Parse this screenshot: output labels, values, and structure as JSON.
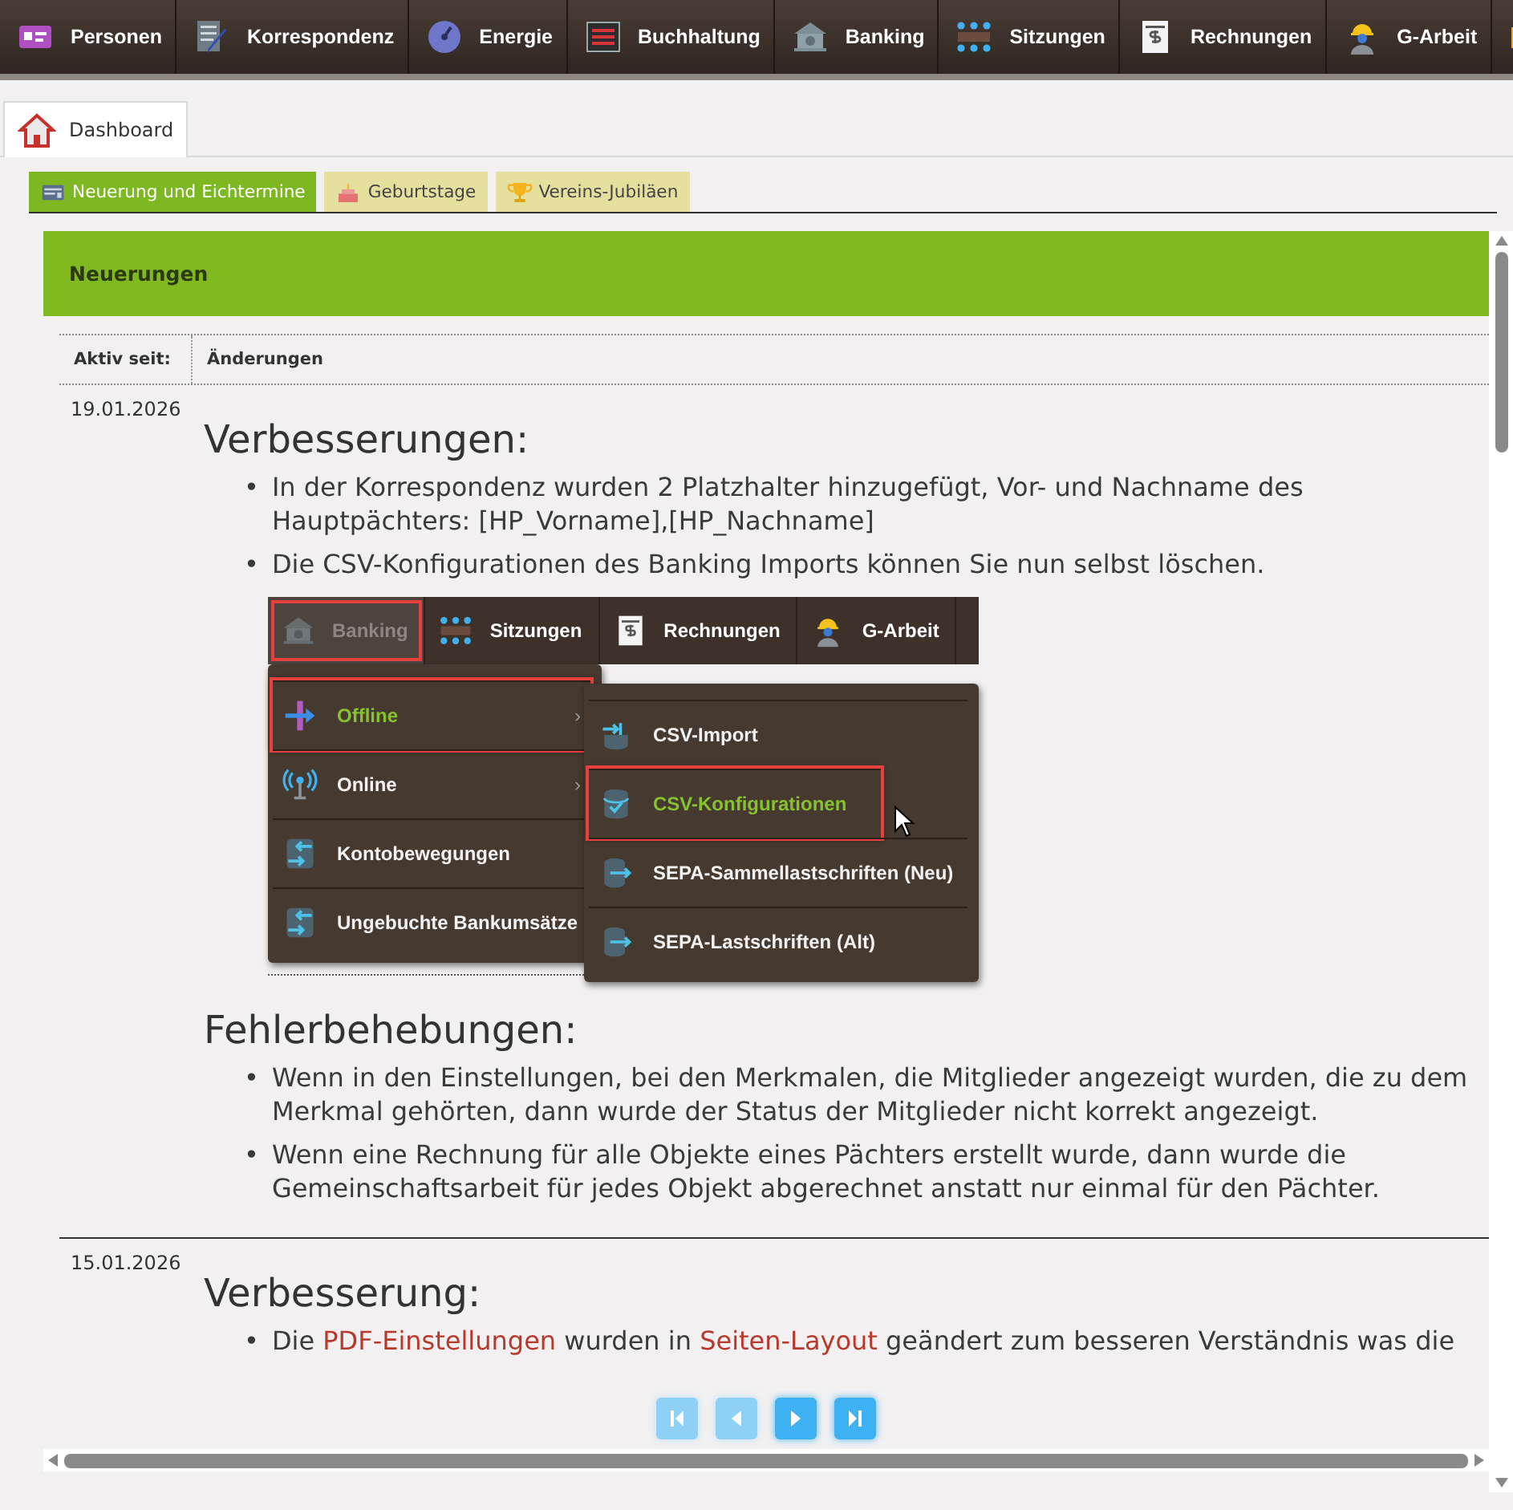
{
  "nav": [
    {
      "label": "Personen"
    },
    {
      "label": "Korrespondenz"
    },
    {
      "label": "Energie"
    },
    {
      "label": "Buchhaltung"
    },
    {
      "label": "Banking"
    },
    {
      "label": "Sitzungen"
    },
    {
      "label": "Rechnungen"
    },
    {
      "label": "G-Arbeit"
    }
  ],
  "tabs": [
    {
      "label": "Dashboard",
      "selected": true
    }
  ],
  "subtabs": [
    {
      "label": "Neuerung und Eichtermine",
      "selected": true
    },
    {
      "label": "Geburtstage",
      "selected": false
    },
    {
      "label": "Vereins-Jubiläen",
      "selected": false
    }
  ],
  "panel_title": "Neuerungen",
  "columns": [
    "Aktiv seit:",
    "Änderungen"
  ],
  "entries": [
    {
      "date": "19.01.2026",
      "sections": [
        {
          "heading": "Verbesserungen:",
          "items": [
            {
              "marker": "•",
              "segments": [
                {
                  "text": "In der Korrespondenz wurden 2 Platzhalter hinzugefügt, Vor- und Nachname des Hauptpächters: [HP_Vorname],[HP_Nachname]",
                  "link": false
                }
              ]
            },
            {
              "marker": "•",
              "segments": [
                {
                  "text": "Die CSV-Konfigurationen des Banking Imports können Sie nun selbst löschen.",
                  "link": false
                }
              ]
            }
          ],
          "screenshot": {
            "menubar": [
              {
                "label": "Banking",
                "highlighted": true
              },
              {
                "label": "Sitzungen",
                "highlighted": false
              },
              {
                "label": "Rechnungen",
                "highlighted": false
              },
              {
                "label": "G-Arbeit",
                "highlighted": false
              }
            ],
            "menu": [
              {
                "label": "Offline",
                "arrow": "›",
                "active": true,
                "highlighted": true
              },
              {
                "label": "Online",
                "arrow": "›",
                "active": false,
                "highlighted": false
              },
              {
                "label": "Kontobewegungen",
                "active": false,
                "highlighted": false
              },
              {
                "label": "Ungebuchte Bankumsätze",
                "active": false,
                "highlighted": false
              }
            ],
            "submenu": [
              {
                "label": "CSV-Import",
                "active": false,
                "highlighted": false
              },
              {
                "label": "CSV-Konfigurationen",
                "active": true,
                "highlighted": true
              },
              {
                "label": "SEPA-Sammellastschriften (Neu)",
                "active": false,
                "highlighted": false
              },
              {
                "label": "SEPA-Lastschriften (Alt)",
                "active": false,
                "highlighted": false
              }
            ]
          }
        },
        {
          "heading": "Fehlerbehebungen:",
          "items": [
            {
              "marker": "•",
              "segments": [
                {
                  "text": "Wenn in den Einstellungen, bei den Merkmalen, die Mitglieder angezeigt wurden, die zu dem Merkmal gehörten, dann wurde der Status der Mitglieder nicht korrekt angezeigt.",
                  "link": false
                }
              ]
            },
            {
              "marker": "•",
              "segments": [
                {
                  "text": "Wenn eine Rechnung für alle Objekte eines Pächters erstellt wurde, dann wurde die Gemeinschaftsarbeit für jedes Objekt abgerechnet anstatt nur einmal für den Pächter.",
                  "link": false
                }
              ]
            }
          ]
        }
      ]
    },
    {
      "date": "15.01.2026",
      "sections": [
        {
          "heading": "Verbesserung:",
          "items": [
            {
              "marker": "•",
              "segments": [
                {
                  "text": "Die ",
                  "link": false
                },
                {
                  "text": "PDF-Einstellungen",
                  "link": true
                },
                {
                  "text": " wurden in ",
                  "link": false
                },
                {
                  "text": "Seiten-Layout",
                  "link": true
                },
                {
                  "text": " geändert zum besseren Verständnis was die",
                  "link": false
                }
              ]
            }
          ]
        }
      ]
    }
  ],
  "pager": [
    {
      "disabled": true
    },
    {
      "disabled": true
    },
    {
      "disabled": false
    },
    {
      "disabled": false
    }
  ]
}
